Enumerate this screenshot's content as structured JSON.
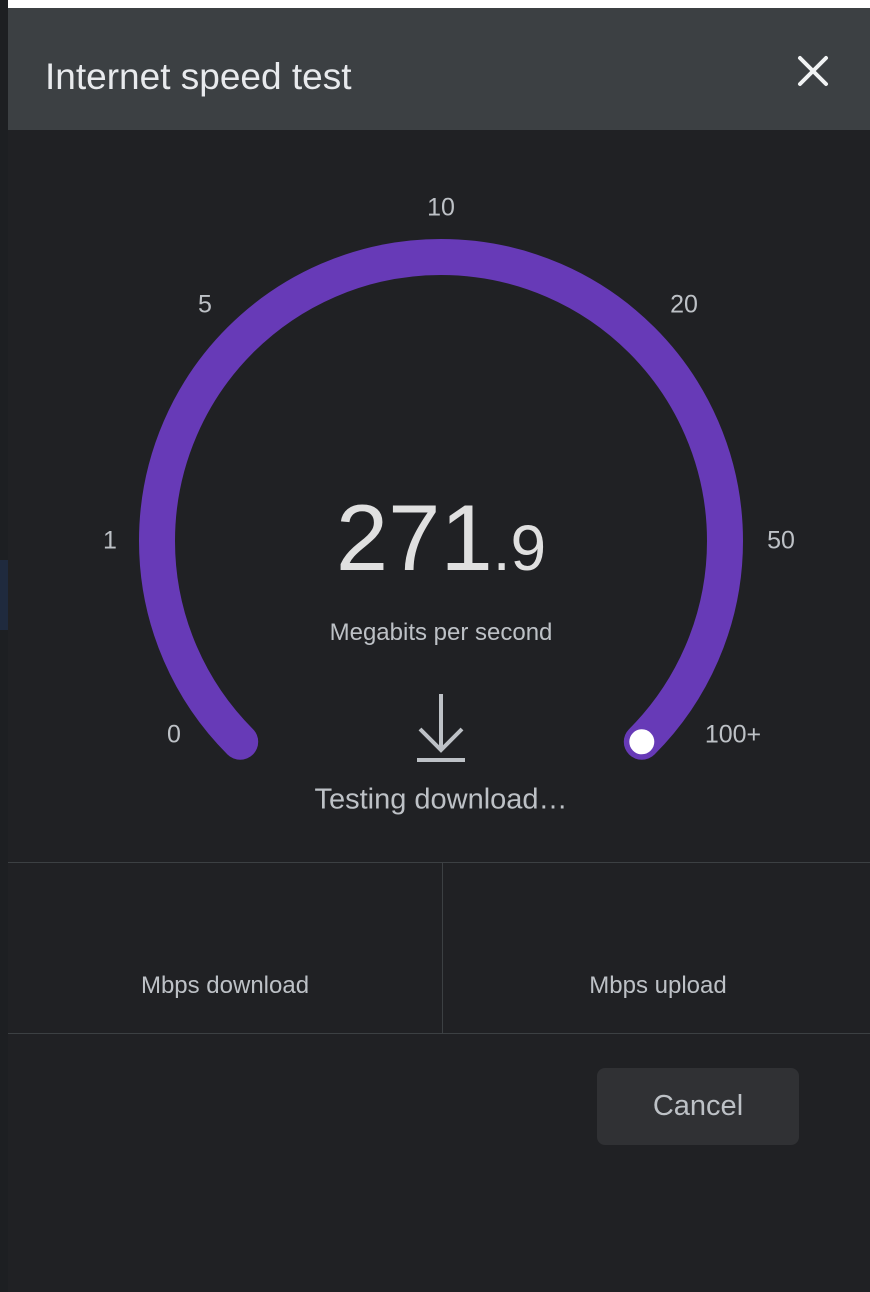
{
  "dialog": {
    "title": "Internet speed test",
    "close_icon": "close-icon"
  },
  "gauge": {
    "value_integer": "271",
    "value_fraction": ".9",
    "unit": "Megabits per second",
    "ticks": [
      "0",
      "1",
      "5",
      "10",
      "20",
      "50",
      "100+"
    ],
    "progress": 1.0,
    "arc_color": "#673ab7",
    "knob_color": "#ffffff"
  },
  "status": {
    "icon": "download-arrow-icon",
    "text": "Testing download…"
  },
  "results": {
    "download_label": "Mbps download",
    "upload_label": "Mbps upload"
  },
  "actions": {
    "cancel_label": "Cancel"
  }
}
